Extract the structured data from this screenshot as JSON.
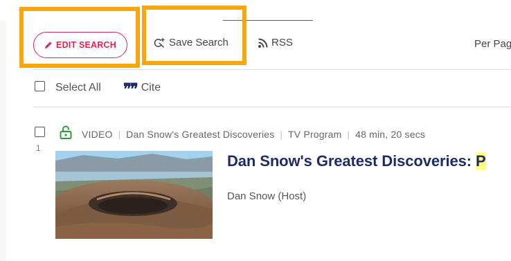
{
  "toolbar": {
    "edit_search_label": "EDIT SEARCH",
    "save_search_label": "Save Search",
    "rss_label": "RSS",
    "per_page_label": "Per Pag"
  },
  "selection": {
    "select_all_label": "Select All",
    "cite_icon": "❞❞",
    "cite_label": "Cite"
  },
  "result": {
    "number": "1",
    "access_icon": "unlocked-icon",
    "media_type": "VIDEO",
    "series": "Dan Snow's Greatest Discoveries",
    "format": "TV Program",
    "duration": "48 min, 20 secs",
    "title_text": "Dan Snow's Greatest Discoveries: ",
    "title_highlight": "P",
    "contributor": "Dan Snow (Host)"
  },
  "colors": {
    "accent": "#d6294d",
    "title": "#1e2b66",
    "highlight_box": "#f7a70a",
    "access_icon": "#2a9d3a",
    "search_term_highlight": "#ffff80"
  }
}
